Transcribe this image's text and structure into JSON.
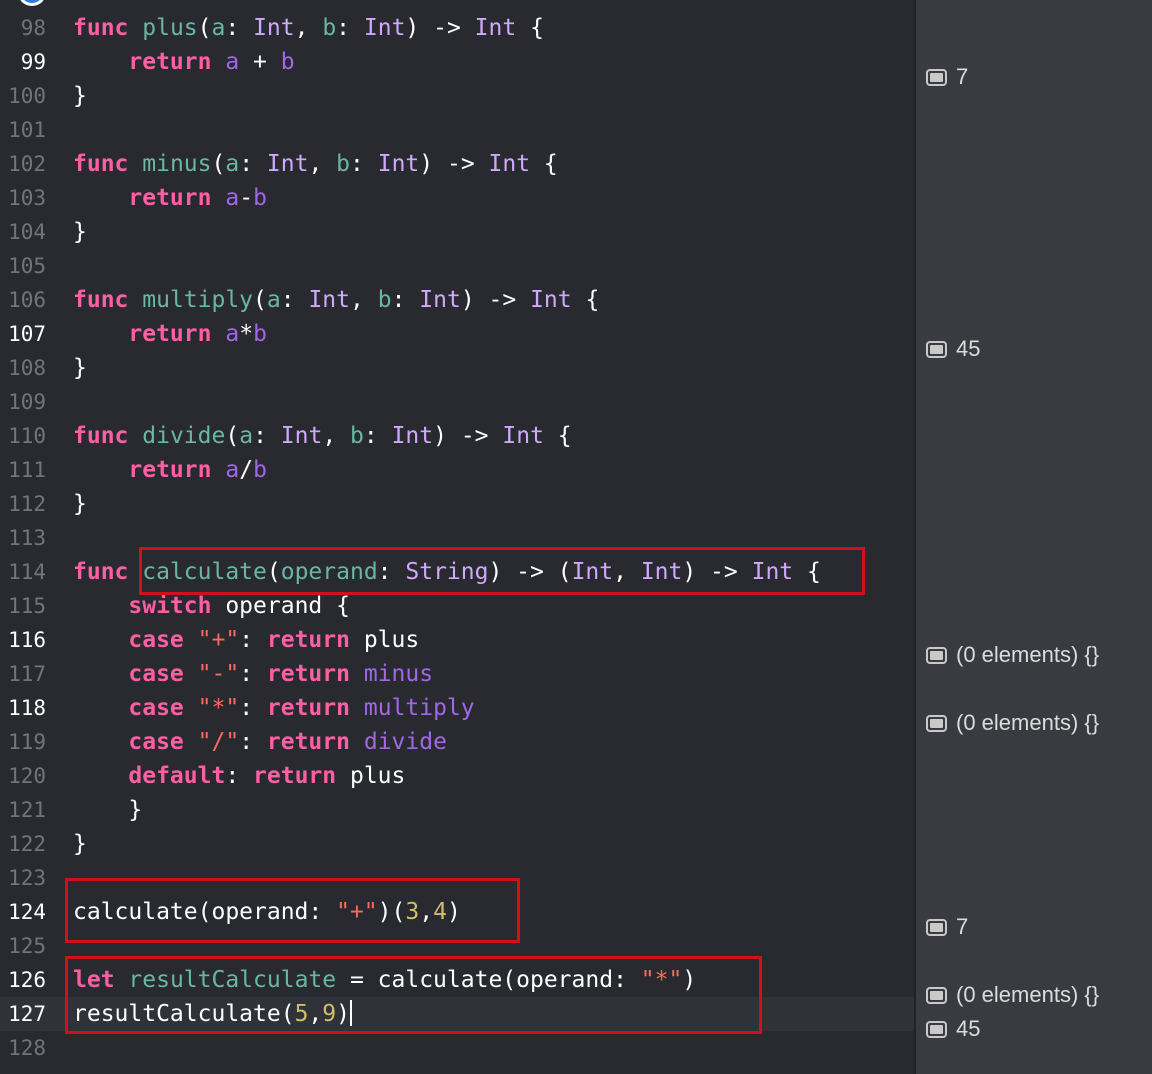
{
  "lines": [
    {
      "number": "98",
      "tokens": [
        {
          "c": "k",
          "t": "func"
        },
        {
          "c": "",
          "t": " "
        },
        {
          "c": "p",
          "t": "plus"
        },
        {
          "c": "",
          "t": "("
        },
        {
          "c": "p",
          "t": "a"
        },
        {
          "c": "",
          "t": ": "
        },
        {
          "c": "t",
          "t": "Int"
        },
        {
          "c": "",
          "t": ", "
        },
        {
          "c": "p",
          "t": "b"
        },
        {
          "c": "",
          "t": ": "
        },
        {
          "c": "t",
          "t": "Int"
        },
        {
          "c": "",
          "t": ") -> "
        },
        {
          "c": "t",
          "t": "Int"
        },
        {
          "c": "",
          "t": " {"
        }
      ]
    },
    {
      "number": "99",
      "tokens": [
        {
          "c": "",
          "t": "    "
        },
        {
          "c": "k",
          "t": "return"
        },
        {
          "c": "",
          "t": " "
        },
        {
          "c": "f",
          "t": "a"
        },
        {
          "c": "",
          "t": " + "
        },
        {
          "c": "f",
          "t": "b"
        }
      ]
    },
    {
      "number": "100",
      "tokens": [
        {
          "c": "",
          "t": "}"
        }
      ]
    },
    {
      "number": "101",
      "tokens": []
    },
    {
      "number": "102",
      "tokens": [
        {
          "c": "k",
          "t": "func"
        },
        {
          "c": "",
          "t": " "
        },
        {
          "c": "p",
          "t": "minus"
        },
        {
          "c": "",
          "t": "("
        },
        {
          "c": "p",
          "t": "a"
        },
        {
          "c": "",
          "t": ": "
        },
        {
          "c": "t",
          "t": "Int"
        },
        {
          "c": "",
          "t": ", "
        },
        {
          "c": "p",
          "t": "b"
        },
        {
          "c": "",
          "t": ": "
        },
        {
          "c": "t",
          "t": "Int"
        },
        {
          "c": "",
          "t": ") -> "
        },
        {
          "c": "t",
          "t": "Int"
        },
        {
          "c": "",
          "t": " {"
        }
      ]
    },
    {
      "number": "103",
      "tokens": [
        {
          "c": "",
          "t": "    "
        },
        {
          "c": "k",
          "t": "return"
        },
        {
          "c": "",
          "t": " "
        },
        {
          "c": "f",
          "t": "a"
        },
        {
          "c": "",
          "t": "-"
        },
        {
          "c": "f",
          "t": "b"
        }
      ]
    },
    {
      "number": "104",
      "tokens": [
        {
          "c": "",
          "t": "}"
        }
      ]
    },
    {
      "number": "105",
      "tokens": []
    },
    {
      "number": "106",
      "tokens": [
        {
          "c": "k",
          "t": "func"
        },
        {
          "c": "",
          "t": " "
        },
        {
          "c": "p",
          "t": "multiply"
        },
        {
          "c": "",
          "t": "("
        },
        {
          "c": "p",
          "t": "a"
        },
        {
          "c": "",
          "t": ": "
        },
        {
          "c": "t",
          "t": "Int"
        },
        {
          "c": "",
          "t": ", "
        },
        {
          "c": "p",
          "t": "b"
        },
        {
          "c": "",
          "t": ": "
        },
        {
          "c": "t",
          "t": "Int"
        },
        {
          "c": "",
          "t": ") -> "
        },
        {
          "c": "t",
          "t": "Int"
        },
        {
          "c": "",
          "t": " {"
        }
      ]
    },
    {
      "number": "107",
      "tokens": [
        {
          "c": "",
          "t": "    "
        },
        {
          "c": "k",
          "t": "return"
        },
        {
          "c": "",
          "t": " "
        },
        {
          "c": "f",
          "t": "a"
        },
        {
          "c": "",
          "t": "*"
        },
        {
          "c": "f",
          "t": "b"
        }
      ]
    },
    {
      "number": "108",
      "tokens": [
        {
          "c": "",
          "t": "}"
        }
      ]
    },
    {
      "number": "109",
      "tokens": []
    },
    {
      "number": "110",
      "tokens": [
        {
          "c": "k",
          "t": "func"
        },
        {
          "c": "",
          "t": " "
        },
        {
          "c": "p",
          "t": "divide"
        },
        {
          "c": "",
          "t": "("
        },
        {
          "c": "p",
          "t": "a"
        },
        {
          "c": "",
          "t": ": "
        },
        {
          "c": "t",
          "t": "Int"
        },
        {
          "c": "",
          "t": ", "
        },
        {
          "c": "p",
          "t": "b"
        },
        {
          "c": "",
          "t": ": "
        },
        {
          "c": "t",
          "t": "Int"
        },
        {
          "c": "",
          "t": ") -> "
        },
        {
          "c": "t",
          "t": "Int"
        },
        {
          "c": "",
          "t": " {"
        }
      ]
    },
    {
      "number": "111",
      "tokens": [
        {
          "c": "",
          "t": "    "
        },
        {
          "c": "k",
          "t": "return"
        },
        {
          "c": "",
          "t": " "
        },
        {
          "c": "f",
          "t": "a"
        },
        {
          "c": "",
          "t": "/"
        },
        {
          "c": "f",
          "t": "b"
        }
      ]
    },
    {
      "number": "112",
      "tokens": [
        {
          "c": "",
          "t": "}"
        }
      ]
    },
    {
      "number": "113",
      "tokens": []
    },
    {
      "number": "114",
      "tokens": [
        {
          "c": "k",
          "t": "func"
        },
        {
          "c": "",
          "t": " "
        },
        {
          "c": "p",
          "t": "calculate"
        },
        {
          "c": "",
          "t": "("
        },
        {
          "c": "p",
          "t": "operand"
        },
        {
          "c": "",
          "t": ": "
        },
        {
          "c": "t",
          "t": "String"
        },
        {
          "c": "",
          "t": ") -> ("
        },
        {
          "c": "t",
          "t": "Int"
        },
        {
          "c": "",
          "t": ", "
        },
        {
          "c": "t",
          "t": "Int"
        },
        {
          "c": "",
          "t": ") -> "
        },
        {
          "c": "t",
          "t": "Int"
        },
        {
          "c": "",
          "t": " {"
        }
      ]
    },
    {
      "number": "115",
      "tokens": [
        {
          "c": "",
          "t": "    "
        },
        {
          "c": "k",
          "t": "switch"
        },
        {
          "c": "",
          "t": " operand {"
        }
      ]
    },
    {
      "number": "116",
      "tokens": [
        {
          "c": "",
          "t": "    "
        },
        {
          "c": "k",
          "t": "case"
        },
        {
          "c": "",
          "t": " "
        },
        {
          "c": "s",
          "t": "\"+\""
        },
        {
          "c": "",
          "t": ": "
        },
        {
          "c": "k",
          "t": "return"
        },
        {
          "c": "",
          "t": " plus"
        }
      ]
    },
    {
      "number": "117",
      "tokens": [
        {
          "c": "",
          "t": "    "
        },
        {
          "c": "k",
          "t": "case"
        },
        {
          "c": "",
          "t": " "
        },
        {
          "c": "s",
          "t": "\"-\""
        },
        {
          "c": "",
          "t": ": "
        },
        {
          "c": "k",
          "t": "return"
        },
        {
          "c": "",
          "t": " "
        },
        {
          "c": "f",
          "t": "minus"
        }
      ]
    },
    {
      "number": "118",
      "tokens": [
        {
          "c": "",
          "t": "    "
        },
        {
          "c": "k",
          "t": "case"
        },
        {
          "c": "",
          "t": " "
        },
        {
          "c": "s",
          "t": "\"*\""
        },
        {
          "c": "",
          "t": ": "
        },
        {
          "c": "k",
          "t": "return"
        },
        {
          "c": "",
          "t": " "
        },
        {
          "c": "f",
          "t": "multiply"
        }
      ]
    },
    {
      "number": "119",
      "tokens": [
        {
          "c": "",
          "t": "    "
        },
        {
          "c": "k",
          "t": "case"
        },
        {
          "c": "",
          "t": " "
        },
        {
          "c": "s",
          "t": "\"/\""
        },
        {
          "c": "",
          "t": ": "
        },
        {
          "c": "k",
          "t": "return"
        },
        {
          "c": "",
          "t": " "
        },
        {
          "c": "f",
          "t": "divide"
        }
      ]
    },
    {
      "number": "120",
      "tokens": [
        {
          "c": "",
          "t": "    "
        },
        {
          "c": "k",
          "t": "default"
        },
        {
          "c": "",
          "t": ": "
        },
        {
          "c": "k",
          "t": "return"
        },
        {
          "c": "",
          "t": " plus"
        }
      ]
    },
    {
      "number": "121",
      "tokens": [
        {
          "c": "",
          "t": "    }"
        }
      ]
    },
    {
      "number": "122",
      "tokens": [
        {
          "c": "",
          "t": "}"
        }
      ]
    },
    {
      "number": "123",
      "tokens": []
    },
    {
      "number": "124",
      "tokens": [
        {
          "c": "",
          "t": "calculate(operand: "
        },
        {
          "c": "s",
          "t": "\"+\""
        },
        {
          "c": "",
          "t": ")("
        },
        {
          "c": "n",
          "t": "3"
        },
        {
          "c": "",
          "t": ","
        },
        {
          "c": "n",
          "t": "4"
        },
        {
          "c": "",
          "t": ")"
        }
      ]
    },
    {
      "number": "125",
      "tokens": []
    },
    {
      "number": "126",
      "tokens": [
        {
          "c": "k",
          "t": "let"
        },
        {
          "c": "",
          "t": " "
        },
        {
          "c": "p",
          "t": "resultCalculate"
        },
        {
          "c": "",
          "t": " = calculate(operand: "
        },
        {
          "c": "s",
          "t": "\"*\""
        },
        {
          "c": "",
          "t": ")"
        }
      ]
    },
    {
      "number": "127",
      "tokens": [
        {
          "c": "",
          "t": "resultCalculate("
        },
        {
          "c": "n",
          "t": "5"
        },
        {
          "c": "",
          "t": ","
        },
        {
          "c": "n",
          "t": "9"
        },
        {
          "c": "",
          "t": ")"
        }
      ]
    },
    {
      "number": "128",
      "tokens": []
    }
  ],
  "results": [
    {
      "line": "99",
      "value": "7"
    },
    {
      "line": "107",
      "value": "45"
    },
    {
      "line": "116",
      "value": "(0 elements) {}"
    },
    {
      "line": "118",
      "value": "(0 elements) {}"
    },
    {
      "line": "124",
      "value": "7"
    },
    {
      "line": "126",
      "value": "(0 elements) {}"
    },
    {
      "line": "127",
      "value": "45"
    }
  ],
  "current_line": "127",
  "colors": {
    "background": "#292a30",
    "keyword": "#fc5fa3",
    "type": "#d0a8ff",
    "declaration": "#67b7a4",
    "other_function": "#a167e6",
    "string": "#fc6a5d",
    "number": "#d0bf69",
    "highlight_box": "#d1101a",
    "breakpoint": "#3479e1"
  }
}
